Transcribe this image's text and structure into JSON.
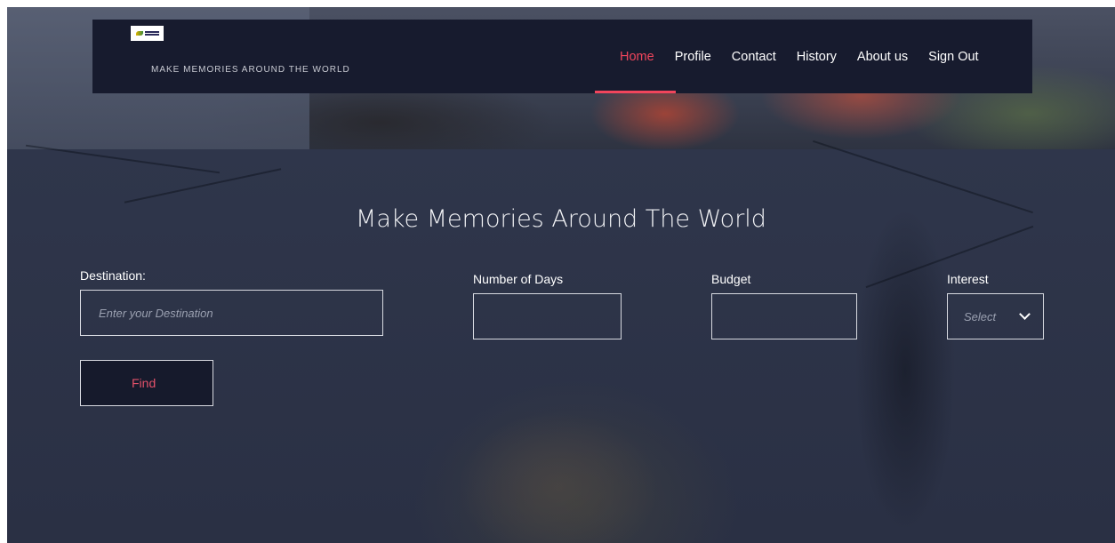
{
  "brand": {
    "tagline": "MAKE MEMORIES AROUND THE WORLD",
    "logo_icon": "travel-explorer-logo",
    "accent_color": "#f1455c"
  },
  "nav": {
    "items": [
      {
        "label": "Home",
        "active": true
      },
      {
        "label": "Profile",
        "active": false
      },
      {
        "label": "Contact",
        "active": false
      },
      {
        "label": "History",
        "active": false
      },
      {
        "label": "About us",
        "active": false
      },
      {
        "label": "Sign Out",
        "active": false
      }
    ]
  },
  "hero": {
    "headline": "Make Memories Around The World"
  },
  "search_form": {
    "destination": {
      "label": "Destination:",
      "value": "",
      "placeholder": "Enter your Destination"
    },
    "days": {
      "label": "Number of Days",
      "value": ""
    },
    "budget": {
      "label": "Budget",
      "value": ""
    },
    "interest": {
      "label": "Interest",
      "selected": "Select",
      "icon": "chevron-down-icon"
    },
    "find_label": "Find"
  }
}
